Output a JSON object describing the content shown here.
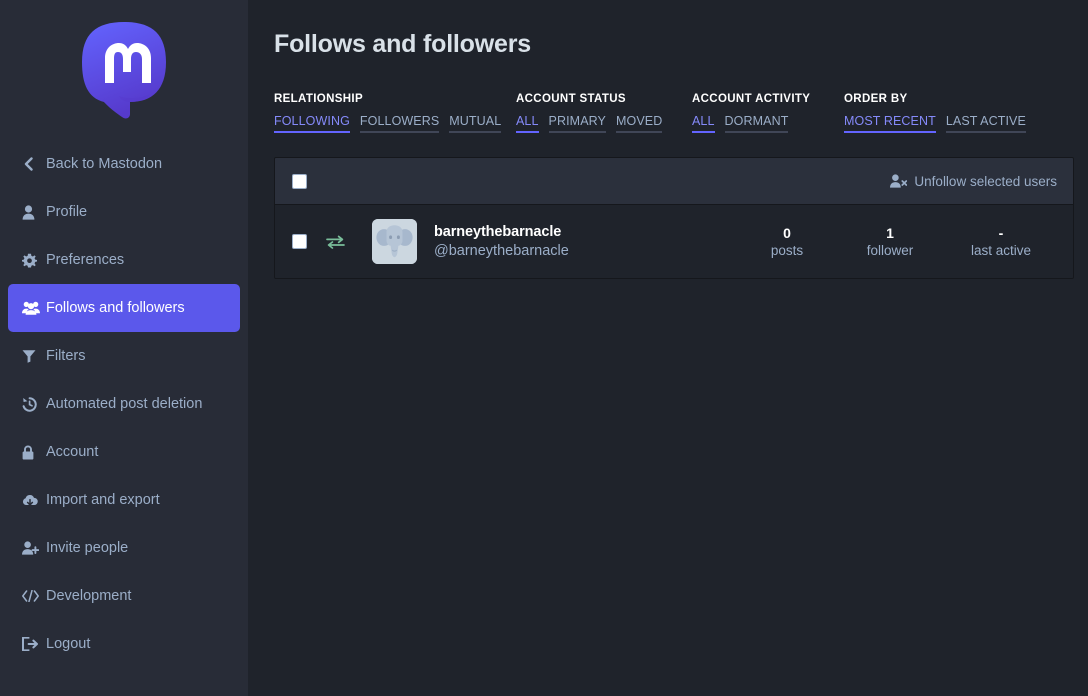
{
  "sidebar": {
    "logo_name": "mastodon-logo",
    "items": [
      {
        "label": "Back to Mastodon",
        "icon": "chevron-left-icon",
        "active": false
      },
      {
        "label": "Profile",
        "icon": "user-icon",
        "active": false
      },
      {
        "label": "Preferences",
        "icon": "gear-icon",
        "active": false
      },
      {
        "label": "Follows and followers",
        "icon": "users-icon",
        "active": true
      },
      {
        "label": "Filters",
        "icon": "funnel-icon",
        "active": false
      },
      {
        "label": "Automated post deletion",
        "icon": "history-icon",
        "active": false
      },
      {
        "label": "Account",
        "icon": "lock-icon",
        "active": false
      },
      {
        "label": "Import and export",
        "icon": "cloud-download-icon",
        "active": false
      },
      {
        "label": "Invite people",
        "icon": "user-plus-icon",
        "active": false
      },
      {
        "label": "Development",
        "icon": "code-icon",
        "active": false
      },
      {
        "label": "Logout",
        "icon": "sign-out-icon",
        "active": false
      }
    ]
  },
  "main": {
    "title": "Follows and followers",
    "filters": [
      {
        "heading": "RELATIONSHIP",
        "options": [
          {
            "label": "FOLLOWING",
            "selected": true
          },
          {
            "label": "FOLLOWERS",
            "selected": false
          },
          {
            "label": "MUTUAL",
            "selected": false
          }
        ]
      },
      {
        "heading": "ACCOUNT STATUS",
        "options": [
          {
            "label": "ALL",
            "selected": true
          },
          {
            "label": "PRIMARY",
            "selected": false
          },
          {
            "label": "MOVED",
            "selected": false
          }
        ]
      },
      {
        "heading": "ACCOUNT ACTIVITY",
        "options": [
          {
            "label": "ALL",
            "selected": true
          },
          {
            "label": "DORMANT",
            "selected": false
          }
        ]
      },
      {
        "heading": "ORDER BY",
        "options": [
          {
            "label": "MOST RECENT",
            "selected": true
          },
          {
            "label": "LAST ACTIVE",
            "selected": false
          }
        ]
      }
    ],
    "table": {
      "select_all_checked": false,
      "bulk_action": {
        "label": "Unfollow selected users",
        "icon": "user-minus-icon"
      },
      "rows": [
        {
          "checked": false,
          "relationship_icon": "mutual-exchange-icon",
          "avatar_icon": "elephant-avatar",
          "display_name": "barneythebarnacle",
          "handle": "@barneythebarnacle",
          "stats": [
            {
              "value": "0",
              "label": "posts"
            },
            {
              "value": "1",
              "label": "follower"
            },
            {
              "value": "-",
              "label": "last active"
            }
          ]
        }
      ]
    }
  },
  "colors": {
    "accent": "#5b58eb",
    "accent_text": "#858afa",
    "sidebar_bg": "#282c37",
    "main_bg": "#1f232b",
    "card_head_bg": "#2b303c",
    "muted_text": "#9baec8",
    "mutual_green": "#79bd9a"
  }
}
